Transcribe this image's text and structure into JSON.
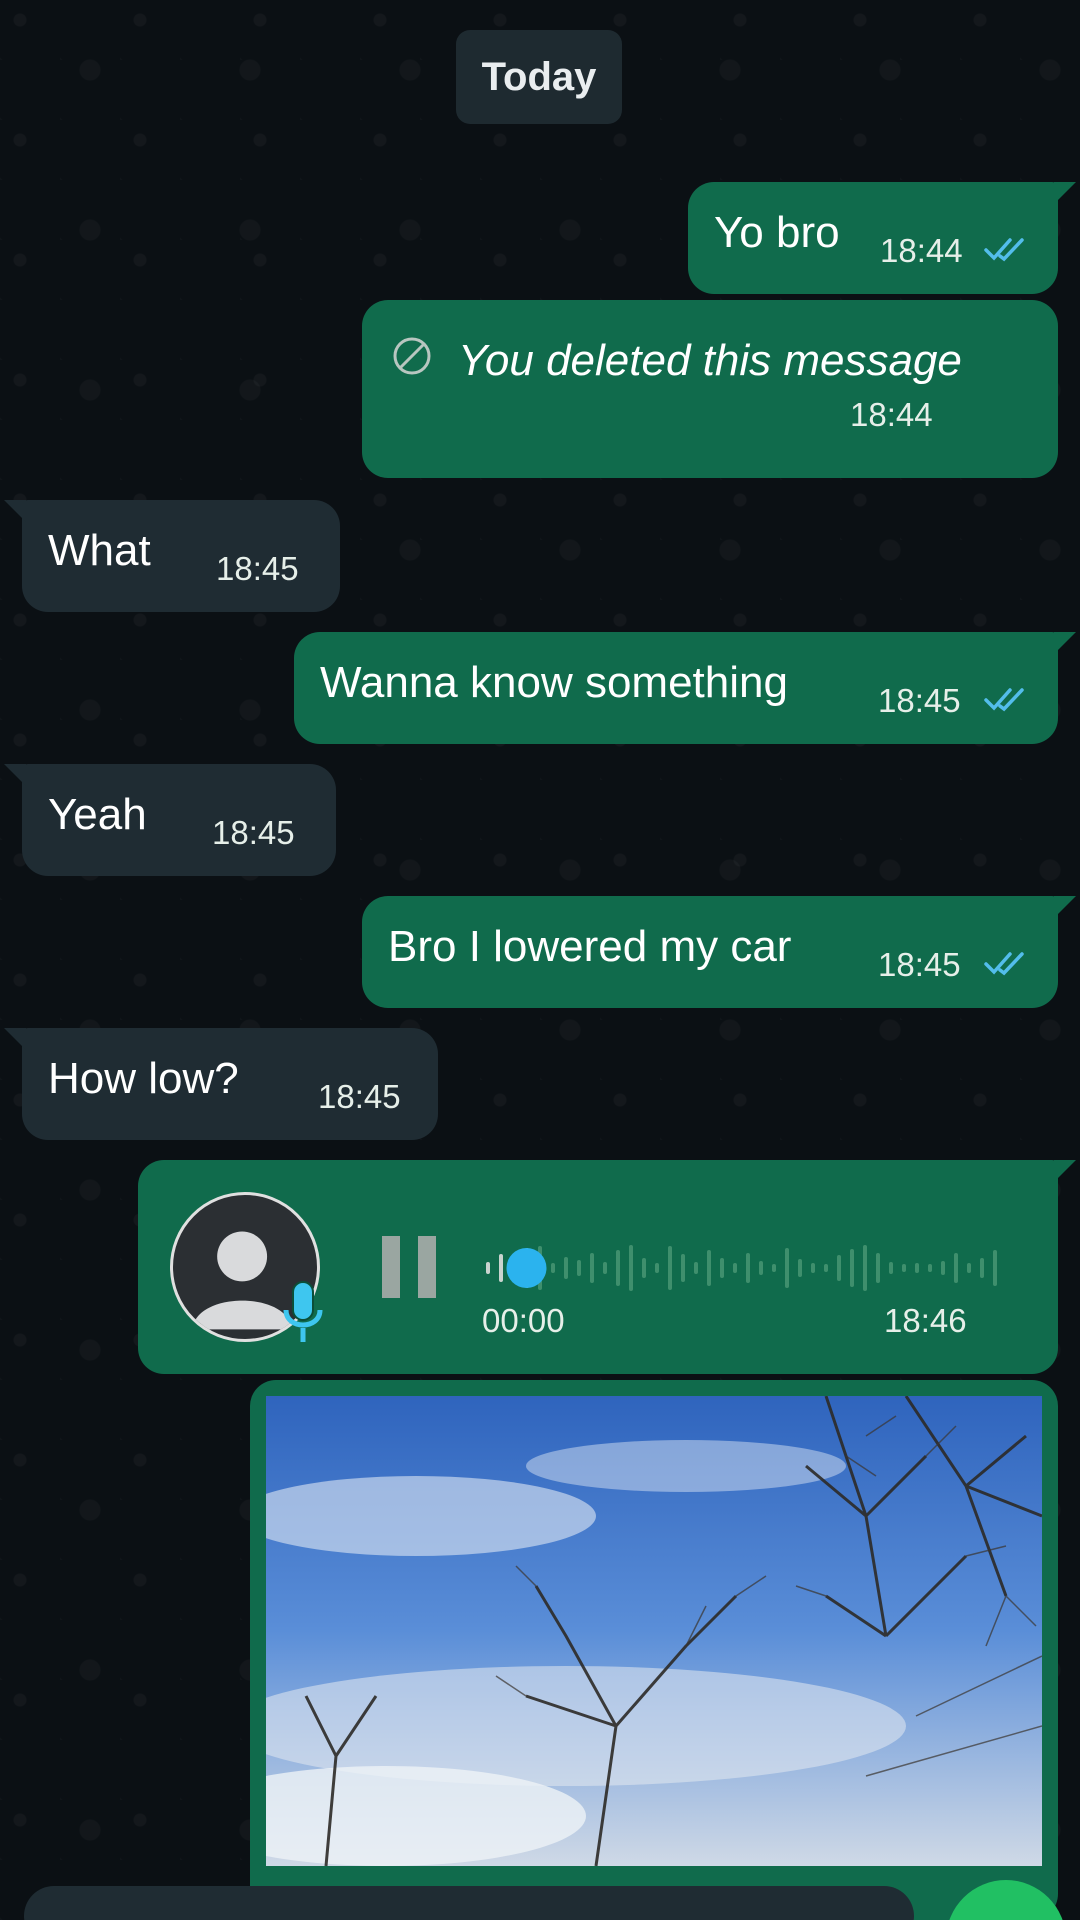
{
  "date_separator": "Today",
  "messages": [
    {
      "direction": "out",
      "text": "Yo bro",
      "time": "18:44",
      "status": "read"
    },
    {
      "direction": "out",
      "deleted": true,
      "text": "You deleted this message",
      "time": "18:44"
    },
    {
      "direction": "in",
      "text": "What",
      "time": "18:45"
    },
    {
      "direction": "out",
      "text": "Wanna know something",
      "time": "18:45",
      "status": "read"
    },
    {
      "direction": "in",
      "text": "Yeah",
      "time": "18:45"
    },
    {
      "direction": "out",
      "text": "Bro I lowered my car",
      "time": "18:45",
      "status": "read"
    },
    {
      "direction": "in",
      "text": "How low?",
      "time": "18:45"
    }
  ],
  "voice_note": {
    "elapsed": "00:00",
    "time": "18:46",
    "state": "playing",
    "progress": 0.05
  },
  "image_message": {
    "content": "photo of bare trees under a blue sky with clouds"
  },
  "colors": {
    "outgoing_bubble": "#106b4c",
    "incoming_bubble": "#1f2c33",
    "read_ticks": "#53bdeb",
    "accent": "#21c063"
  },
  "icons": {
    "read_receipt": "double-check-icon",
    "deleted": "ban-icon",
    "voice": "mic-icon",
    "playback": "pause-icon"
  }
}
